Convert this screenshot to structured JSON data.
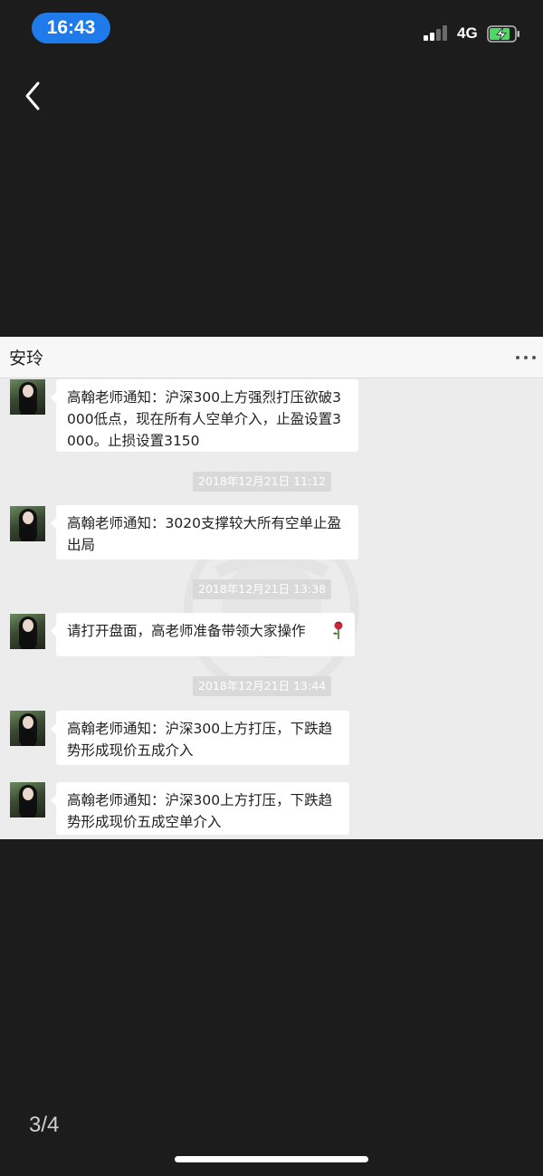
{
  "status_bar": {
    "time": "16:43",
    "network": "4G"
  },
  "chat": {
    "title": "安玲",
    "messages": [
      {
        "text": "高翰老师通知：沪深300上方强烈打压欲破3\n000低点，现在所有人空单介入，止盈设置3\n000。止损设置3150"
      },
      {
        "timestamp": "2018年12月21日 11:12"
      },
      {
        "text": "高翰老师通知：3020支撑较大所有空单止盈\n出局"
      },
      {
        "timestamp": "2018年12月21日 13:38"
      },
      {
        "text": "请打开盘面，高老师准备带领大家操作",
        "emoji": "rose-icon"
      },
      {
        "timestamp": "2018年12月21日 13:44"
      },
      {
        "text": "高翰老师通知：沪深300上方打压，下跌趋\n势形成现价五成介入"
      },
      {
        "text": "高翰老师通知：沪深300上方打压，下跌趋\n势形成现价五成空单介入"
      }
    ]
  },
  "viewer": {
    "page_indicator": "3/4"
  },
  "colors": {
    "time_pill": "#1e7be9",
    "battery_fill": "#4cd964",
    "background": "#1c1c1c"
  }
}
